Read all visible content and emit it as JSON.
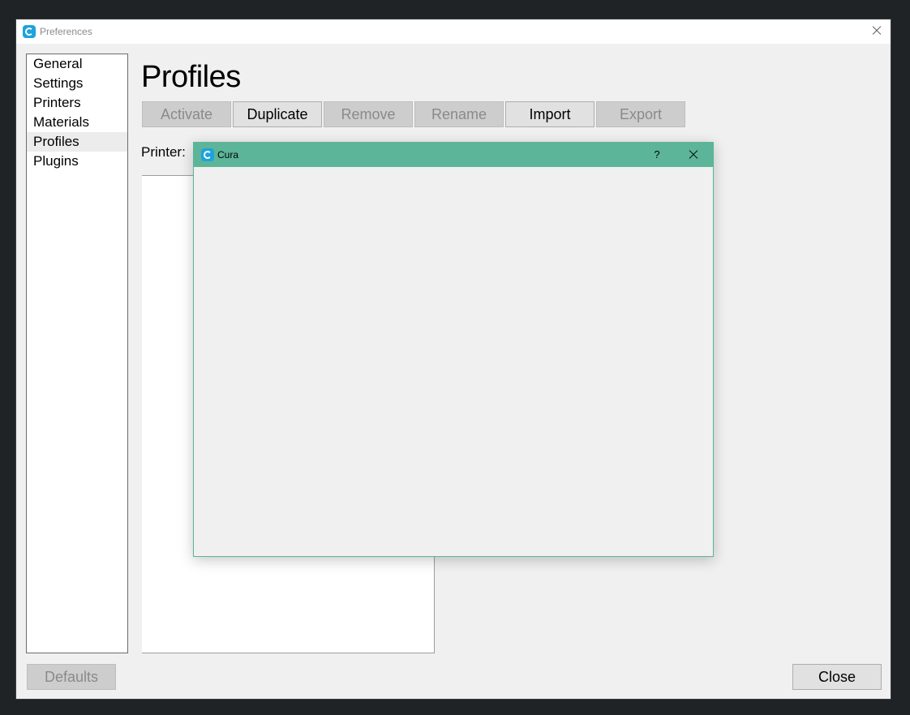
{
  "window": {
    "title": "Preferences",
    "close_icon": "close-icon",
    "app_icon": "cura-logo-icon"
  },
  "sidebar": {
    "items": [
      {
        "label": "General"
      },
      {
        "label": "Settings"
      },
      {
        "label": "Printers"
      },
      {
        "label": "Materials"
      },
      {
        "label": "Profiles",
        "selected": true
      },
      {
        "label": "Plugins"
      }
    ]
  },
  "page": {
    "title": "Profiles",
    "printer_label": "Printer:"
  },
  "toolbar": {
    "buttons": [
      {
        "label": "Activate",
        "enabled": false
      },
      {
        "label": "Duplicate",
        "enabled": true
      },
      {
        "label": "Remove",
        "enabled": false
      },
      {
        "label": "Rename",
        "enabled": false
      },
      {
        "label": "Import",
        "enabled": true
      },
      {
        "label": "Export",
        "enabled": false
      }
    ]
  },
  "footer": {
    "defaults_label": "Defaults",
    "close_label": "Close"
  },
  "dialog": {
    "title": "Cura",
    "help_label": "?",
    "titlebar_color": "#5cb598",
    "close_icon": "close-icon"
  }
}
